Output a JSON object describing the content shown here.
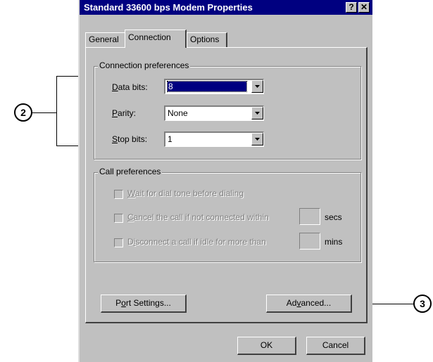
{
  "window": {
    "title": "Standard 33600 bps Modem Properties",
    "help_button": "?",
    "close_button": "✕"
  },
  "tabs": [
    {
      "label": "General",
      "active": false
    },
    {
      "label": "Connection",
      "active": true
    },
    {
      "label": "Options",
      "active": false
    }
  ],
  "connection_preferences": {
    "legend": "Connection preferences",
    "data_bits": {
      "label_hotkey": "D",
      "label_rest": "ata bits:",
      "value": "8"
    },
    "parity": {
      "label_hotkey": "P",
      "label_rest": "arity:",
      "value": "None"
    },
    "stop_bits": {
      "label_hotkey": "S",
      "label_rest": "top bits:",
      "value": "1"
    }
  },
  "call_preferences": {
    "legend": "Call preferences",
    "wait_dial_tone": {
      "hotkey": "W",
      "rest": "ait for dial tone before dialing",
      "checked": false,
      "enabled": false
    },
    "cancel_call": {
      "hotkey": "C",
      "rest": "ancel the call if not connected within",
      "unit": "secs",
      "checked": false,
      "enabled": false
    },
    "disconnect_idle": {
      "prefix": "D",
      "hotkey": "i",
      "rest": "sconnect a call if idle for more than",
      "unit": "mins",
      "checked": false,
      "enabled": false
    }
  },
  "buttons": {
    "port_settings": {
      "pre": "P",
      "hotkey": "o",
      "post": "rt Settings..."
    },
    "advanced": {
      "pre": "Ad",
      "hotkey": "v",
      "post": "anced..."
    },
    "ok": "OK",
    "cancel": "Cancel"
  },
  "callouts": {
    "left": "2",
    "right": "3"
  }
}
